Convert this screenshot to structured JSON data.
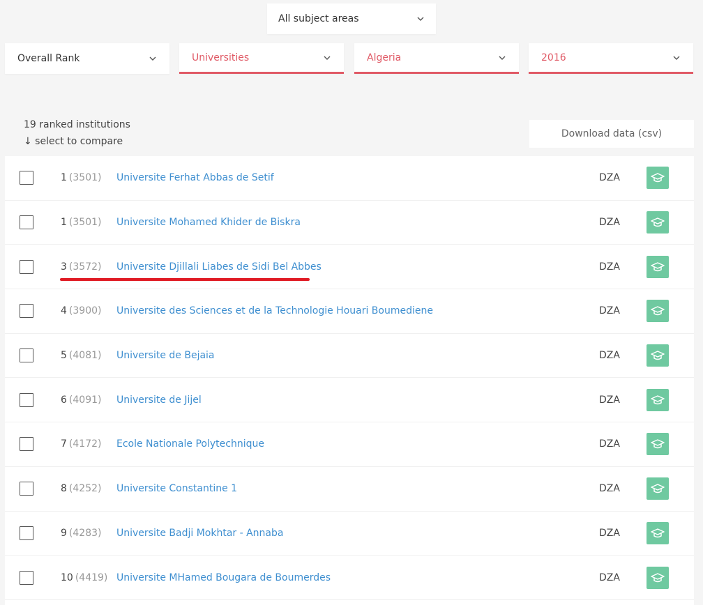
{
  "filters": {
    "subject": "All subject areas",
    "rank": "Overall Rank",
    "type": "Universities",
    "country": "Algeria",
    "year": "2016"
  },
  "summary": {
    "count_text": "19 ranked institutions",
    "compare_text": "↓ select to compare"
  },
  "download_label": "Download data (csv)",
  "accent_color": "#e05a66",
  "link_color": "#3f8fd0",
  "profile_icon_color": "#6fc9a0",
  "rows": [
    {
      "rank": "1",
      "score": "(3501)",
      "name": "Universite Ferhat Abbas de Setif",
      "country": "DZA"
    },
    {
      "rank": "1",
      "score": "(3501)",
      "name": "Universite Mohamed Khider de Biskra",
      "country": "DZA"
    },
    {
      "rank": "3",
      "score": "(3572)",
      "name": "Universite Djillali Liabes de Sidi Bel Abbes",
      "country": "DZA"
    },
    {
      "rank": "4",
      "score": "(3900)",
      "name": "Universite des Sciences et de la Technologie Houari Boumediene",
      "country": "DZA"
    },
    {
      "rank": "5",
      "score": "(4081)",
      "name": "Universite de Bejaia",
      "country": "DZA"
    },
    {
      "rank": "6",
      "score": "(4091)",
      "name": "Universite de Jijel",
      "country": "DZA"
    },
    {
      "rank": "7",
      "score": "(4172)",
      "name": "Ecole Nationale Polytechnique",
      "country": "DZA"
    },
    {
      "rank": "8",
      "score": "(4252)",
      "name": "Universite Constantine 1",
      "country": "DZA"
    },
    {
      "rank": "9",
      "score": "(4283)",
      "name": "Universite Badji Mokhtar - Annaba",
      "country": "DZA"
    },
    {
      "rank": "10",
      "score": "(4419)",
      "name": "Universite MHamed Bougara de Boumerdes",
      "country": "DZA"
    }
  ]
}
